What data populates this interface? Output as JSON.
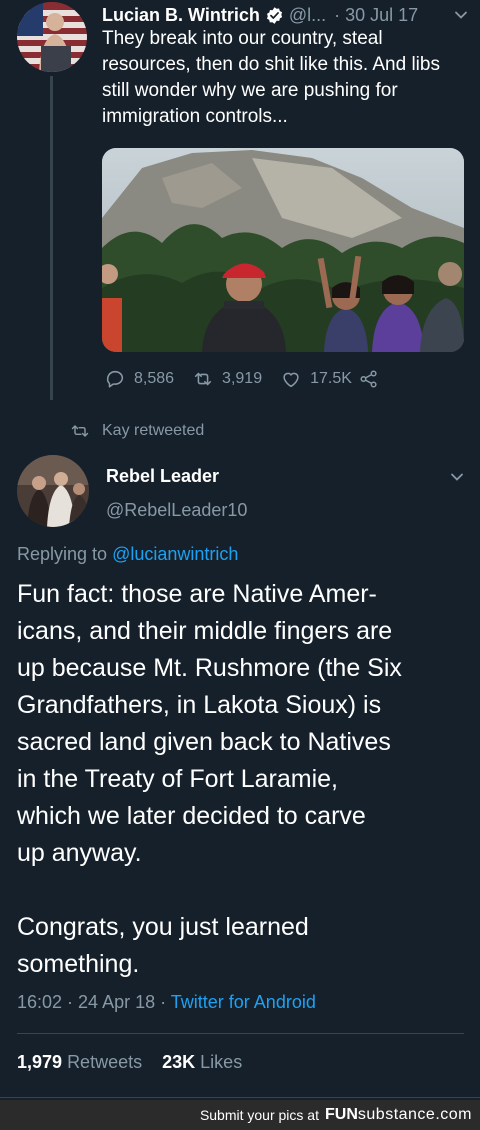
{
  "tweet1": {
    "author_name": "Lucian B. Wintrich",
    "handle": "@l...",
    "date": "· 30 Jul 17",
    "text": "They break into our country, steal resources, then do shit like this. And libs still wonder why we are pushing for immigration controls...",
    "replies": "8,586",
    "retweets": "3,919",
    "likes": "17.5K",
    "icons": [
      "verified-badge-icon",
      "chevron-down-icon",
      "reply-icon",
      "retweet-icon",
      "heart-icon",
      "share-icon"
    ]
  },
  "retweet_label": "Kay retweeted",
  "tweet2": {
    "author_name": "Rebel Leader",
    "handle": "@RebelLeader10",
    "replying_prefix": "Replying to ",
    "replying_mention": "@lucianwintrich",
    "text": "Fun fact: those are Native Amer-\nicans, and their middle fingers are\nup because Mt. Rushmore (the Six\nGrandfathers, in Lakota Sioux) is\nsacred land given back to Natives\nin the Treaty of Fort Laramie,\nwhich we later decided to carve\nup anyway.\n\nCongrats, you just learned\nsomething.",
    "timestamp": "16:02 · 24 Apr 18 · ",
    "client": "Twitter for Android",
    "retweet_count": "1,979",
    "retweet_word": "Retweets",
    "like_count": "23K",
    "like_word": "Likes"
  },
  "footer": {
    "text": "Submit your pics at",
    "brand_a": "FUN",
    "brand_b": "substance",
    "brand_c": ".com"
  },
  "colors": {
    "background": "#15202b",
    "muted": "#8899a6",
    "link": "#1da1f2",
    "divider": "#38444d"
  }
}
